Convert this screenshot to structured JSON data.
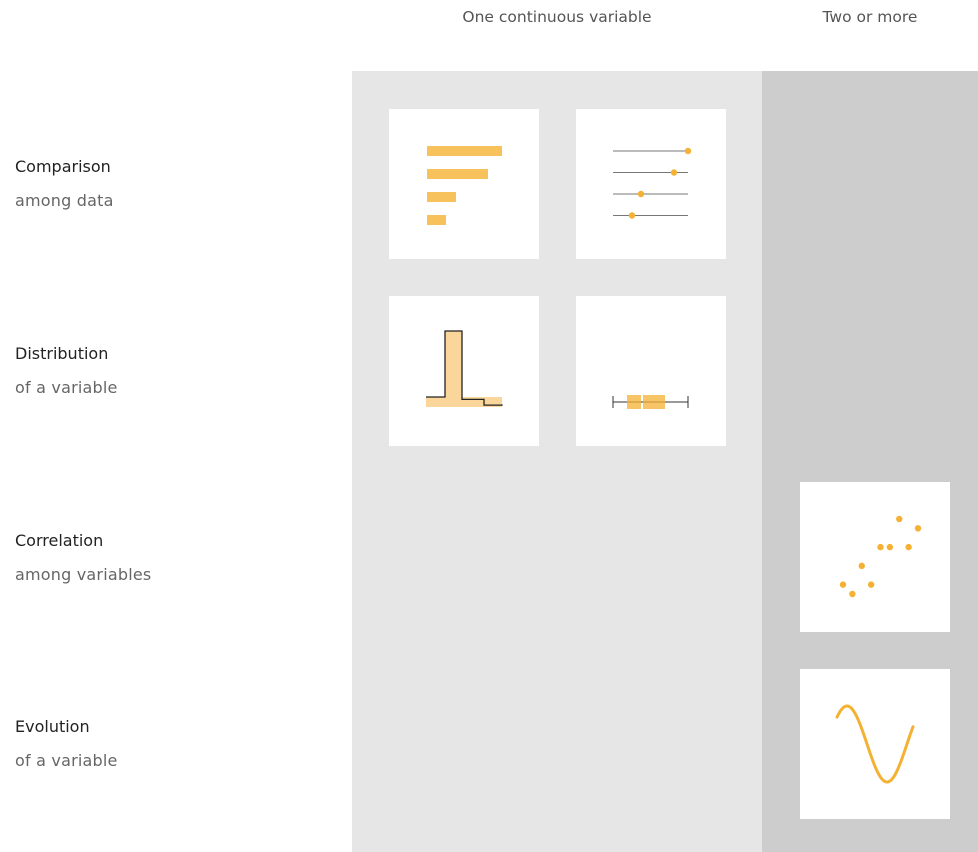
{
  "columns": {
    "one_continuous": "One continuous variable",
    "two_or_more": "Two or more"
  },
  "rows": {
    "comparison": {
      "title": "Comparison",
      "subtitle": "among data"
    },
    "distribution": {
      "title": "Distribution",
      "subtitle": "of a variable"
    },
    "correlation": {
      "title": "Correlation",
      "subtitle": "among variables"
    },
    "evolution": {
      "title": "Evolution",
      "subtitle": "of a variable"
    }
  },
  "colors": {
    "panel_one_bg": "#e6e6e6",
    "panel_two_bg": "#cdcdcd",
    "accent": "#f5b133",
    "accent_light": "#fad69a",
    "line": "#777777"
  },
  "thumbnails": {
    "barplot": {
      "icon": "horizontal-barplot-icon",
      "values": [
        75,
        61,
        29,
        19
      ]
    },
    "lollipop": {
      "icon": "lollipop-chart-icon",
      "values": [
        75,
        61,
        28,
        19
      ]
    },
    "histogram": {
      "icon": "histogram-icon",
      "values": [
        10,
        1,
        0.25,
        0.35
      ]
    },
    "boxplot": {
      "icon": "boxplot-icon",
      "values": [
        0,
        14,
        28,
        52,
        75
      ]
    },
    "scatter": {
      "icon": "scatter-plot-icon",
      "points": [
        [
          1,
          2
        ],
        [
          2,
          1
        ],
        [
          3,
          4
        ],
        [
          4,
          2
        ],
        [
          5,
          6
        ],
        [
          6,
          6
        ],
        [
          7,
          9
        ],
        [
          8,
          6
        ],
        [
          9,
          8
        ]
      ]
    },
    "line": {
      "icon": "sine-line-chart-icon",
      "cycles": 1
    }
  }
}
